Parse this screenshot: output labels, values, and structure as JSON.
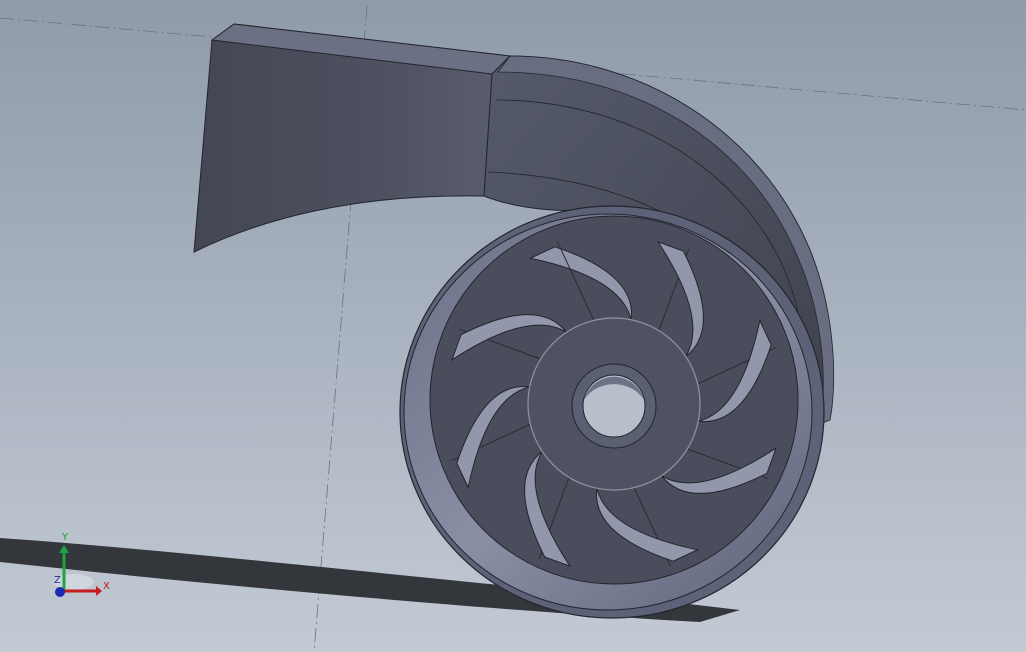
{
  "viewport": {
    "background_top": "#8f9bab",
    "background_bottom": "#c3cad4",
    "part_color": "#4d5160",
    "part_highlight": "#8a8fa5",
    "edge_color": "#23252d",
    "shadow_color": "#2b2e33"
  },
  "triad": {
    "x_label": "X",
    "y_label": "Y",
    "z_label": "Z",
    "x_color": "#c81b1b",
    "y_color": "#1aa63a",
    "z_color": "#1d2ab5"
  },
  "impeller": {
    "blade_count": 8
  }
}
